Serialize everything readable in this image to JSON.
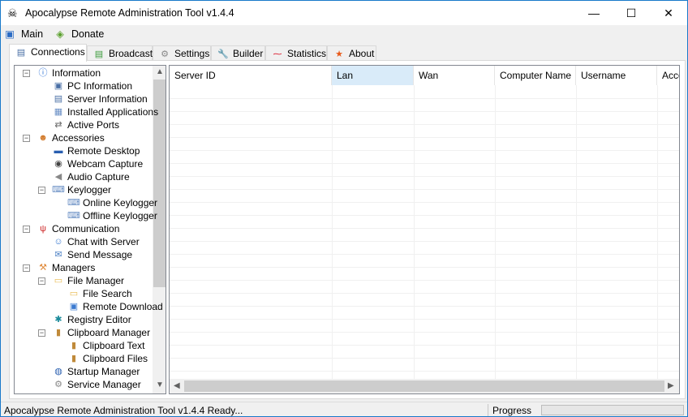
{
  "window": {
    "title": "Apocalypse Remote Administration Tool v1.4.4",
    "minimize": "—",
    "maximize": "☐",
    "close": "✕"
  },
  "menu": [
    {
      "label": "Main",
      "icon": "monitor-icon"
    },
    {
      "label": "Donate",
      "icon": "money-icon"
    }
  ],
  "tabs": [
    {
      "label": "Connections",
      "icon": "server-icon",
      "active": true
    },
    {
      "label": "Broadcast",
      "icon": "broadcast-icon"
    },
    {
      "label": "Settings",
      "icon": "gear-icon"
    },
    {
      "label": "Builder",
      "icon": "wrench-icon"
    },
    {
      "label": "Statistics",
      "icon": "chart-icon"
    },
    {
      "label": "About",
      "icon": "star-icon"
    }
  ],
  "tree": [
    {
      "label": "Information",
      "level": 0,
      "icon": "info-icon",
      "expanded": true
    },
    {
      "label": "PC Information",
      "level": 1,
      "icon": "computer-icon"
    },
    {
      "label": "Server Information",
      "level": 1,
      "icon": "server-icon"
    },
    {
      "label": "Installed Applications",
      "level": 1,
      "icon": "apps-icon"
    },
    {
      "label": "Active Ports",
      "level": 1,
      "icon": "ports-icon"
    },
    {
      "label": "Accessories",
      "level": 0,
      "icon": "users-icon",
      "expanded": true
    },
    {
      "label": "Remote Desktop",
      "level": 1,
      "icon": "desktop-icon"
    },
    {
      "label": "Webcam Capture",
      "level": 1,
      "icon": "webcam-icon"
    },
    {
      "label": "Audio Capture",
      "level": 1,
      "icon": "speaker-icon"
    },
    {
      "label": "Keylogger",
      "level": 1,
      "icon": "keyboard-icon",
      "expanded": true
    },
    {
      "label": "Online Keylogger",
      "level": 2,
      "icon": "keyboard-icon"
    },
    {
      "label": "Offline Keylogger",
      "level": 2,
      "icon": "keyboard-icon"
    },
    {
      "label": "Communication",
      "level": 0,
      "icon": "antenna-icon",
      "expanded": true
    },
    {
      "label": "Chat with Server",
      "level": 1,
      "icon": "chat-icon"
    },
    {
      "label": "Send Message",
      "level": 1,
      "icon": "mail-icon"
    },
    {
      "label": "Managers",
      "level": 0,
      "icon": "wrench-icon",
      "expanded": true
    },
    {
      "label": "File Manager",
      "level": 1,
      "icon": "folder-icon",
      "expanded": true
    },
    {
      "label": "File Search",
      "level": 2,
      "icon": "folder-search-icon"
    },
    {
      "label": "Remote Download",
      "level": 2,
      "icon": "download-icon"
    },
    {
      "label": "Registry Editor",
      "level": 1,
      "icon": "registry-icon"
    },
    {
      "label": "Clipboard Manager",
      "level": 1,
      "icon": "clipboard-icon",
      "expanded": true
    },
    {
      "label": "Clipboard Text",
      "level": 2,
      "icon": "clipboard-text-icon"
    },
    {
      "label": "Clipboard Files",
      "level": 2,
      "icon": "clipboard-files-icon"
    },
    {
      "label": "Startup Manager",
      "level": 1,
      "icon": "windows-icon"
    },
    {
      "label": "Service Manager",
      "level": 1,
      "icon": "gear-icon"
    }
  ],
  "grid": {
    "columns": [
      "Server ID",
      "Lan",
      "Wan",
      "Computer Name",
      "Username",
      "Account"
    ],
    "selected_column": 1
  },
  "status": {
    "text": "Apocalypse Remote Administration Tool v1.4.4 Ready...",
    "progress_label": "Progress",
    "progress": 0
  }
}
